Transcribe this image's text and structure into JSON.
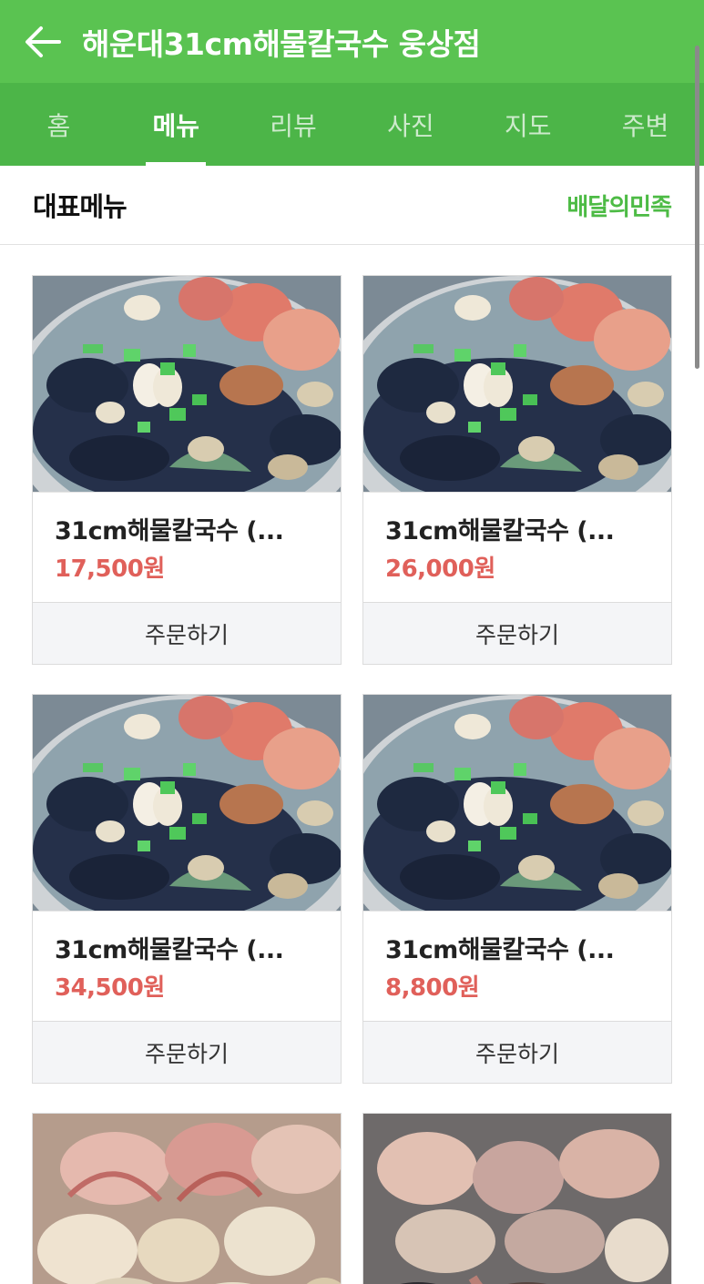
{
  "header": {
    "title": "해운대31cm해물칼국수 웅상점",
    "back_icon": "arrow-left-icon"
  },
  "tabs": [
    {
      "label": "홈",
      "active": false
    },
    {
      "label": "메뉴",
      "active": true
    },
    {
      "label": "리뷰",
      "active": false
    },
    {
      "label": "사진",
      "active": false
    },
    {
      "label": "지도",
      "active": false
    },
    {
      "label": "주변",
      "active": false
    }
  ],
  "section": {
    "title": "대표메뉴",
    "link": "배달의민족"
  },
  "menu": [
    {
      "name": "31cm해물칼국수 (...",
      "price": "17,500원",
      "order": "주문하기"
    },
    {
      "name": "31cm해물칼국수 (...",
      "price": "26,000원",
      "order": "주문하기"
    },
    {
      "name": "31cm해물칼국수 (...",
      "price": "34,500원",
      "order": "주문하기"
    },
    {
      "name": "31cm해물칼국수 (...",
      "price": "8,800원",
      "order": "주문하기"
    },
    {
      "name": "",
      "price": "",
      "order": ""
    },
    {
      "name": "",
      "price": "",
      "order": ""
    }
  ],
  "colors": {
    "header": "#5ac351",
    "tabs": "#4cb548",
    "price": "#e0605a",
    "link": "#4dbb45"
  }
}
